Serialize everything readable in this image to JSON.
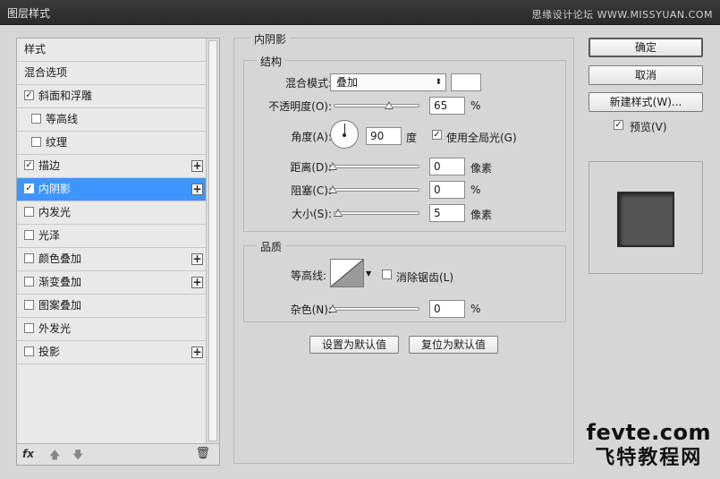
{
  "window": {
    "title": "图层样式",
    "watermark_top": "思缘设计论坛 WWW.MISSYUAN.COM"
  },
  "styles_list": {
    "items": [
      {
        "label": "样式",
        "checkbox": false,
        "checked": false,
        "plus": false,
        "indent": false,
        "selected": false
      },
      {
        "label": "混合选项",
        "checkbox": false,
        "checked": false,
        "plus": false,
        "indent": false,
        "selected": false
      },
      {
        "label": "斜面和浮雕",
        "checkbox": true,
        "checked": true,
        "plus": false,
        "indent": false,
        "selected": false
      },
      {
        "label": "等高线",
        "checkbox": true,
        "checked": false,
        "plus": false,
        "indent": true,
        "selected": false
      },
      {
        "label": "纹理",
        "checkbox": true,
        "checked": false,
        "plus": false,
        "indent": true,
        "selected": false
      },
      {
        "label": "描边",
        "checkbox": true,
        "checked": true,
        "plus": true,
        "indent": false,
        "selected": false
      },
      {
        "label": "内阴影",
        "checkbox": true,
        "checked": true,
        "plus": true,
        "indent": false,
        "selected": true
      },
      {
        "label": "内发光",
        "checkbox": true,
        "checked": false,
        "plus": false,
        "indent": false,
        "selected": false
      },
      {
        "label": "光泽",
        "checkbox": true,
        "checked": false,
        "plus": false,
        "indent": false,
        "selected": false
      },
      {
        "label": "颜色叠加",
        "checkbox": true,
        "checked": false,
        "plus": true,
        "indent": false,
        "selected": false
      },
      {
        "label": "渐变叠加",
        "checkbox": true,
        "checked": false,
        "plus": true,
        "indent": false,
        "selected": false
      },
      {
        "label": "图案叠加",
        "checkbox": true,
        "checked": false,
        "plus": false,
        "indent": false,
        "selected": false
      },
      {
        "label": "外发光",
        "checkbox": true,
        "checked": false,
        "plus": false,
        "indent": false,
        "selected": false
      },
      {
        "label": "投影",
        "checkbox": true,
        "checked": false,
        "plus": true,
        "indent": false,
        "selected": false
      }
    ],
    "footer": {
      "fx": "fx",
      "up_icon": "arrow-up-icon",
      "down_icon": "arrow-down-icon",
      "trash_icon": "trash-icon"
    }
  },
  "settings": {
    "section_title": "内阴影",
    "structure": {
      "title": "结构",
      "blend_mode_label": "混合模式:",
      "blend_mode_value": "叠加",
      "blend_color": "#ffffff",
      "opacity_label": "不透明度(O):",
      "opacity_value": "65",
      "opacity_unit": "%",
      "opacity_fraction": 0.65,
      "angle_label": "角度(A):",
      "angle_value": "90",
      "angle_unit": "度",
      "global_light_label": "使用全局光(G)",
      "global_light_checked": true,
      "distance_label": "距离(D):",
      "distance_value": "0",
      "distance_unit": "像素",
      "choke_label": "阻塞(C):",
      "choke_value": "0",
      "choke_unit": "%",
      "size_label": "大小(S):",
      "size_value": "5",
      "size_unit": "像素"
    },
    "quality": {
      "title": "品质",
      "contour_label": "等高线:",
      "anti_alias_label": "消除锯齿(L)",
      "anti_alias_checked": false,
      "noise_label": "杂色(N):",
      "noise_value": "0",
      "noise_unit": "%"
    },
    "make_default": "设置为默认值",
    "reset_default": "复位为默认值"
  },
  "right_panel": {
    "ok": "确定",
    "cancel": "取消",
    "new_style": "新建样式(W)...",
    "preview_label": "预览(V)",
    "preview_checked": true,
    "preview_color": "#555555"
  },
  "watermark_bottom": {
    "line1": "fevte.com",
    "line2": "飞特教程网"
  }
}
